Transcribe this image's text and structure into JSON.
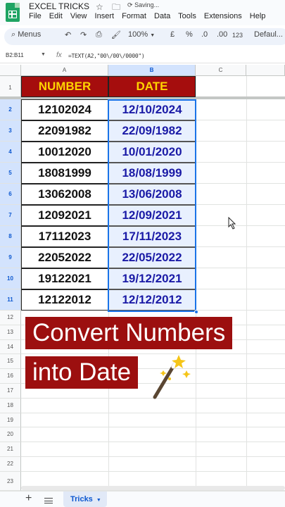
{
  "app": {
    "doc_title": "EXCEL TRICKS",
    "saving_status": "Saving..."
  },
  "menu": [
    "File",
    "Edit",
    "View",
    "Insert",
    "Format",
    "Data",
    "Tools",
    "Extensions",
    "Help"
  ],
  "toolbar": {
    "menus_label": "Menus",
    "zoom": "100%",
    "currency": "£",
    "percent": "%",
    "dec_decrease": ".0",
    "dec_increase": ".00",
    "number_format": "123",
    "font": "Defaul..."
  },
  "formula_bar": {
    "name_box": "B2:B11",
    "fx": "fx",
    "formula": "=TEXT(A2,\"00\\/00\\/0000\")"
  },
  "columns": [
    "A",
    "B",
    "C"
  ],
  "rows": [
    "1",
    "2",
    "3",
    "4",
    "5",
    "6",
    "7",
    "8",
    "9",
    "10",
    "11",
    "12",
    "13",
    "14",
    "15",
    "16",
    "17",
    "18",
    "19",
    "20",
    "21",
    "22",
    "23"
  ],
  "table": {
    "headers": [
      "NUMBER",
      "DATE"
    ],
    "number_col": [
      "12102024",
      "22091982",
      "10012020",
      "18081999",
      "13062008",
      "12092021",
      "17112023",
      "22052022",
      "19122021",
      "12122012"
    ],
    "date_col": [
      "12/10/2024",
      "22/09/1982",
      "10/01/2020",
      "18/08/1999",
      "13/06/2008",
      "12/09/2021",
      "17/11/2023",
      "22/05/2022",
      "19/12/2021",
      "12/12/2012"
    ]
  },
  "overlay": {
    "line1": "Convert Numbers",
    "line2": "into Date"
  },
  "sheet_tabs": {
    "active": "Tricks"
  },
  "colors": {
    "header_fill": "#a50d0d",
    "header_text": "#ffd400",
    "date_text": "#1a1aa6",
    "selection": "#1a73e8",
    "banner": "#9c0f0f"
  }
}
